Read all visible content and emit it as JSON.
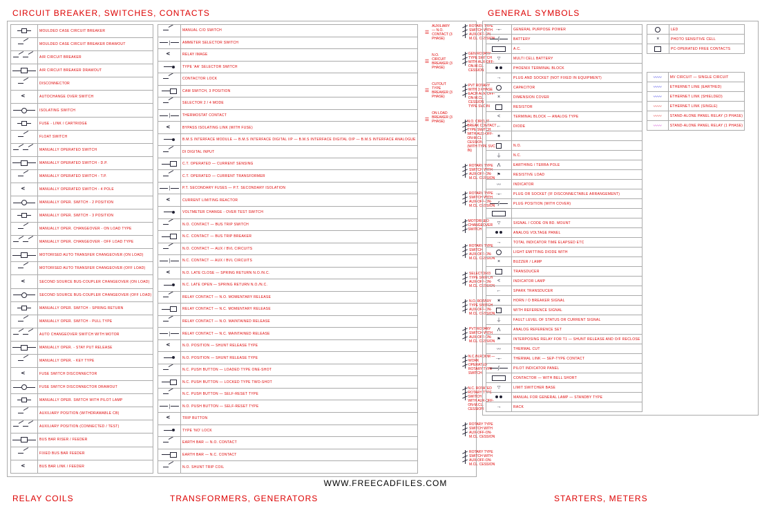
{
  "headings": {
    "circuit": "CIRCUIT BREAKER, SWITCHES, CONTACTS",
    "general": "GENERAL SYMBOLS",
    "relay": "RELAY COILS",
    "transformers": "TRANSFORMERS, GENERATORS",
    "starters": "STARTERS, METERS"
  },
  "watermark": "WWW.FREECADFILES.COM",
  "circuit_col1": [
    "MOULDED CASE CIRCUIT BREAKER",
    "MOULDED CASE CIRCUIT BREAKER DRAWOUT",
    "AIR CIRCUIT BREAKER",
    "AIR CIRCUIT BREAKER DRAWOUT",
    "DISCONNECTOR",
    "AUTOCHANGE OVER SWITCH",
    "ISOLATING SWITCH",
    "FUSE - LINK / CARTRIDGE",
    "FLOAT SWITCH",
    "MANUALLY OPERATED SWITCH",
    "MANUALLY OPERATED SWITCH - D.P.",
    "MANUALLY OPERATED SWITCH - T.P.",
    "MANUALLY OPERATED SWITCH - 4 POLE",
    "MANUALLY OPER. SWITCH - 2 POSITION",
    "MANUALLY OPER. SWITCH - 3 POSITION",
    "MANUALLY OPER. CHANGEOVER - ON LOAD TYPE",
    "MANUALLY OPER. CHANGEOVER - OFF LOAD TYPE",
    "MOTORISED AUTO TRANSFER CHANGEOVER (ON LOAD)",
    "MOTORISED AUTO TRANSFER CHANGEOVER (OFF LOAD)",
    "SECOND SOURCE BUS-COUPLER CHANGEOVER (ON LOAD)",
    "SECOND SOURCE BUS-COUPLER CHANGEOVER (OFF LOAD)",
    "MANUALLY OPER. SWITCH - SPRING RETURN",
    "MANUALLY OPER. SWITCH - PULL TYPE",
    "AUTO CHANGEOVER SWITCH WITH MOTOR",
    "MANUALLY OPER. - STAY PUT RELEASE",
    "MANUALLY OPER. - KEY TYPE",
    "FUSE SWITCH DISCONNECTOR",
    "FUSE SWITCH DISCONNECTOR DRAWOUT",
    "MANUALLY OPER. SWITCH WITH PILOT LAMP",
    "AUXILIARY POSITION (WITHDRAWABLE CB)",
    "AUXILIARY POSITION (CONNECTED / TEST)",
    "BUS BAR RISER / FEEDER",
    "FIXED BUS BAR FEEDER",
    "BUS BAR LINK / FEEDER"
  ],
  "circuit_col2": [
    "MANUAL C/O SWITCH",
    "AMMETER SELECTOR SWITCH",
    "RELAY IMAGE",
    "TYPE 'AA' SELECTOR SWITCH",
    "CONTACTOR LOCK",
    "CAM SWITCH, 3 POSITION",
    "SELECTOR 2 / 4 MODE",
    "THERMOSTAT CONTACT",
    "BYPASS ISOLATING LINK (WITH FUSE)",
    "B.M.S INTERFACE MODULE\\nB.M.S INTERFACE DIGITAL I/P\\nB.M.S INTERFACE DIGITAL O/P\\nB.M.S INTERFACE ANALOGUE",
    "DI DIGITAL INPUT",
    "C.T. OPERATED — CURRENT SENSING",
    "C.T. OPERATED — CURRENT TRANSFORMER",
    "P.T. SECONDARY FUSES\\nP.T. SECONDARY ISOLATION",
    "CURRENT LIMITING REACTOR",
    "VOLTMETER CHANGE - OVER TEST SWITCH",
    "N.O. CONTACT — BUS TRIP SWITCH",
    "N.C. CONTACT — BUS TRIP BREAKER",
    "N.O. CONTACT — AUX / BVL CIRCUITS",
    "N.C. CONTACT — AUX / BVL CIRCUITS",
    "N.O. LATE CLOSE — SPRING RETURN N.O./N.C.",
    "N.C. LATE OPEN — SPRING RETURN N.O./N.C.",
    "RELAY CONTACT — N.O. MOMENTARY RELEASE",
    "RELAY CONTACT — N.C. MOMENTARY RELEASE",
    "RELAY CONTACT — N.O. MAINTAINED RELEASE",
    "RELAY CONTACT — N.C. MAINTAINED RELEASE",
    "N.O. POSITION — SHUNT RELEASE TYPE",
    "N.O. POSITION — SHUNT RELEASE TYPE",
    "N.C. PUSH BUTTON — LOADED TYPE ONE-SHOT",
    "N.C. PUSH BUTTON — LOCKED TYPE TWO-SHOT",
    "N.C. PUSH BUTTON — SELF-RESET TYPE",
    "N.O. PUSH BUTTON — SELF-RESET TYPE",
    "TRIP BUTTON",
    "TYPE 'NO' LOCK",
    "EARTH BAR — N.O. CONTACT",
    "EARTH BAR — N.C. CONTACT",
    "N.O. SHUNT TRIP COIL"
  ],
  "circuit_col3": [
    "AUXILIARY — N.O. CONTACT (3 PHASE)",
    "N.O. CIRCUIT BREAKER (3 PHASE)",
    "CUTOUT TYPE BREAKER (3 PHASE)",
    "ON LOAD BREAKER (3 PHASE)"
  ],
  "circuit_col4": [
    "ROTARY TYPE SWITCH WITH\\nAUX-OFF-ON-M.CL. CESSION",
    "GEN ROTARY TYPE SWITCH\\nWITH AUX-OFF-ON-M.CL. CESSION",
    "PVT ROTARY WITH 3 PHASE\\nEACH AUX-OFF-ON-M.CL. CESSION\\nTYPE SVC IN",
    "N.O. CIRCUIT BREAK CONTACT TYPE SWITCH\\nWITH AUX-OFF-ON-M.CL. CESSION\\n(WITH TYPE SVC IN)",
    "ROTARY TYPE SWITCH WITH\\nAUX-OFF-ON-M.CL. CESSION",
    "ROTARY TYPE SWITCH WITH\\nAUX-OFF-ON-M.CL. CESSION",
    "MOTORISED CHANGEOVER SWITCH",
    "ROTARY TYPE SWITCH\\nAUX-OFF-ON-M.CL. CESSION",
    "SELECTOR/3 TYPE SWITCH\\nAUX-OFF-ON-M.CL. CESSION",
    "N.O. ROTARY TYPE SWITCH\\nAUX-OFF-ON-M.CL. CESSION",
    "PVT ROTARY SWITCH WITH\\nAUX-OFF-ON-M.CL. CESSION",
    "N.C./N.ROOM — WORK OPERATED\\nROTARY TYPE SWITCH",
    "N.C. ROTATED ROTARY TYPE SWITCH\\nWITH AUX-OFF-ON-M.CL. CESSION",
    "ROTARY TYPE SWITCH WITH\\nAUX-OFF-ON-M.CL. CESSION",
    "ROTARY TYPE SWITCH WITH\\nAUX-OFF-ON-M.CL. CESSION"
  ],
  "general_col1": [
    "GENERAL PURPOSE POWER",
    "BATTERY",
    "A.C.",
    "MULTI CELL BATTERY",
    "PHOENIX TERMINAL BLOCK",
    "PLUG AND SOCKET (NOT FIXED IN EQUIPMENT)",
    "CAPACITOR",
    "DIMENSION COVER",
    "RESISTOR",
    "TERMINAL BLOCK — ANALOG TYPE",
    "DIODE",
    "",
    "N.O.",
    "N.C.",
    "EARTHING / TERRA POLE",
    "RESISTIVE LOAD",
    "INDICATOR",
    "PLUG OR SOCKET (IF DISCONNECTABLE ARRANGEMENT)",
    "PLUG POSITION (WITH COVER)",
    "",
    "SIGNAL / CODE ON BD. MOUNT",
    "ANALOG VOLTAGE PANEL",
    "TOTAL INDICATOR TIME ELAPSED ETC",
    "LIGHT EMITTING DIODE WITH",
    "BUZZER / LAMP",
    "TRANSDUCER",
    "INDICATOR LAMP",
    "SPARK TRANSDUCER",
    "HORN / O BREAKER SIGNAL",
    "WITH REFERENCE SIGNAL",
    "FAULT LEVEL OF STATUS OR CURRENT SIGNAL",
    "ANALOG REFERENCE SET",
    "INTERPOSING RELAY FOR T1\\nSHUNT RELEASE AND O/F RECLOSE",
    "THERMAL CUT",
    "THERMAL LINK — SEP-TYPE CONTACT",
    "PILOT INDICATOR PANEL",
    "CONTACTOR — WITH BELL SHORT",
    "LIMIT SWITCHER BASE",
    "MANUAL FOR GENERAL LAMP — STANDBY TYPE",
    "RACK"
  ],
  "general_col2": [
    "LED",
    "PHOTO SENSITIVE CELL",
    "PC-OPERATED FREE CONTACTS"
  ],
  "general_col3": [
    "MV CIRCUIT — SINGLE CIRCUIT",
    "ETHERNET LINE (EARTHED)",
    "ETHERNET LINK (SHIELDED)",
    "ETHERNET LINK (SINGLE)",
    "STAND-ALONE PANEL RELAY (3 PHASE)",
    "STAND-ALONE PANEL RELAY (1 PHASE)"
  ]
}
